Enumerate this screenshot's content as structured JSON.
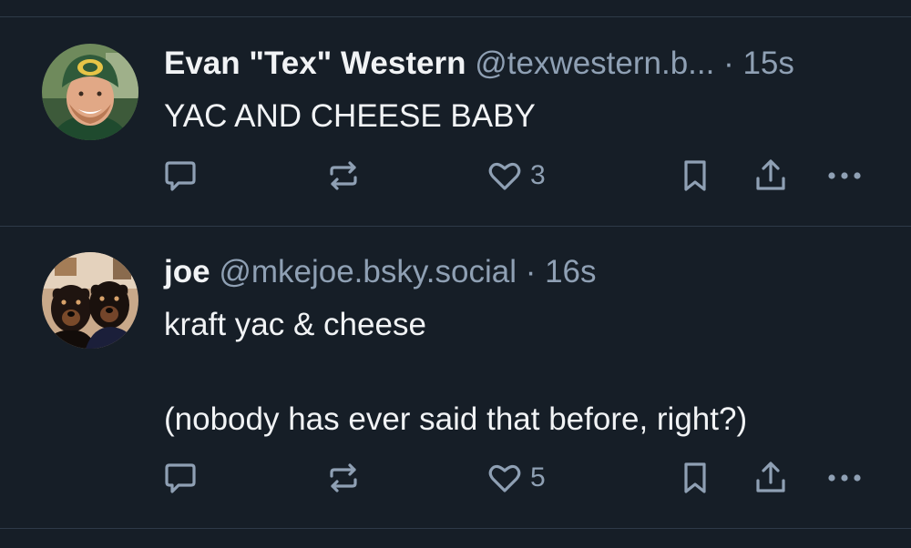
{
  "posts": [
    {
      "author_name": "Evan \"Tex\" Western",
      "handle": "@texwestern.b...",
      "separator": "·",
      "time": "15s",
      "text": "YAC AND CHEESE BABY",
      "like_count": "3"
    },
    {
      "author_name": "joe",
      "handle": "@mkejoe.bsky.social",
      "separator": "·",
      "time": "16s",
      "text": "kraft yac & cheese\n\n(nobody has ever said that before, right?)",
      "like_count": "5"
    }
  ],
  "icons": {
    "reply": "reply-icon",
    "repost": "repost-icon",
    "like": "heart-icon",
    "bookmark": "bookmark-icon",
    "share": "share-icon",
    "more": "more-icon"
  },
  "colors": {
    "background": "#161e27",
    "divider": "#2e3a48",
    "text": "#f1f3f5",
    "muted": "#8fa0b4"
  }
}
